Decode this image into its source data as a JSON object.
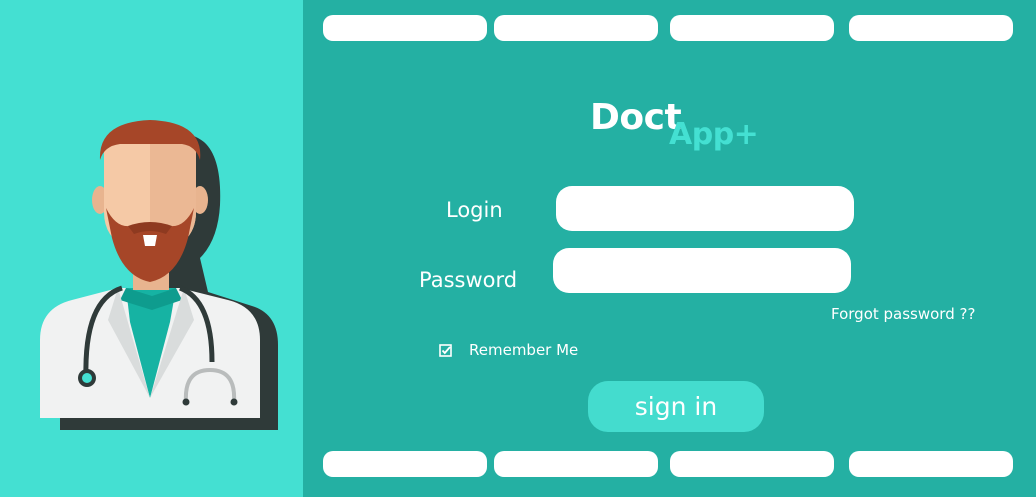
{
  "colors": {
    "main_background": "#24b0a3",
    "left_panel_background": "#44e0d2",
    "accent": "#44e0d2",
    "button_background": "#44dcce",
    "input_background": "#ffffff"
  },
  "top_nav": [
    {
      "label": ""
    },
    {
      "label": ""
    },
    {
      "label": ""
    },
    {
      "label": ""
    }
  ],
  "bottom_nav": [
    {
      "label": ""
    },
    {
      "label": ""
    },
    {
      "label": ""
    },
    {
      "label": ""
    }
  ],
  "illustration": {
    "icon": "doctor-avatar-icon"
  },
  "logo": {
    "part1": "Doct",
    "part2": "App+"
  },
  "form": {
    "login_label": "Login",
    "login_value": "",
    "login_placeholder": "",
    "password_label": "Password",
    "password_value": "",
    "password_placeholder": "",
    "forgot_password": "Forgot password ??",
    "remember_me": "Remember Me",
    "remember_checked": true,
    "submit_label": "sign in"
  }
}
